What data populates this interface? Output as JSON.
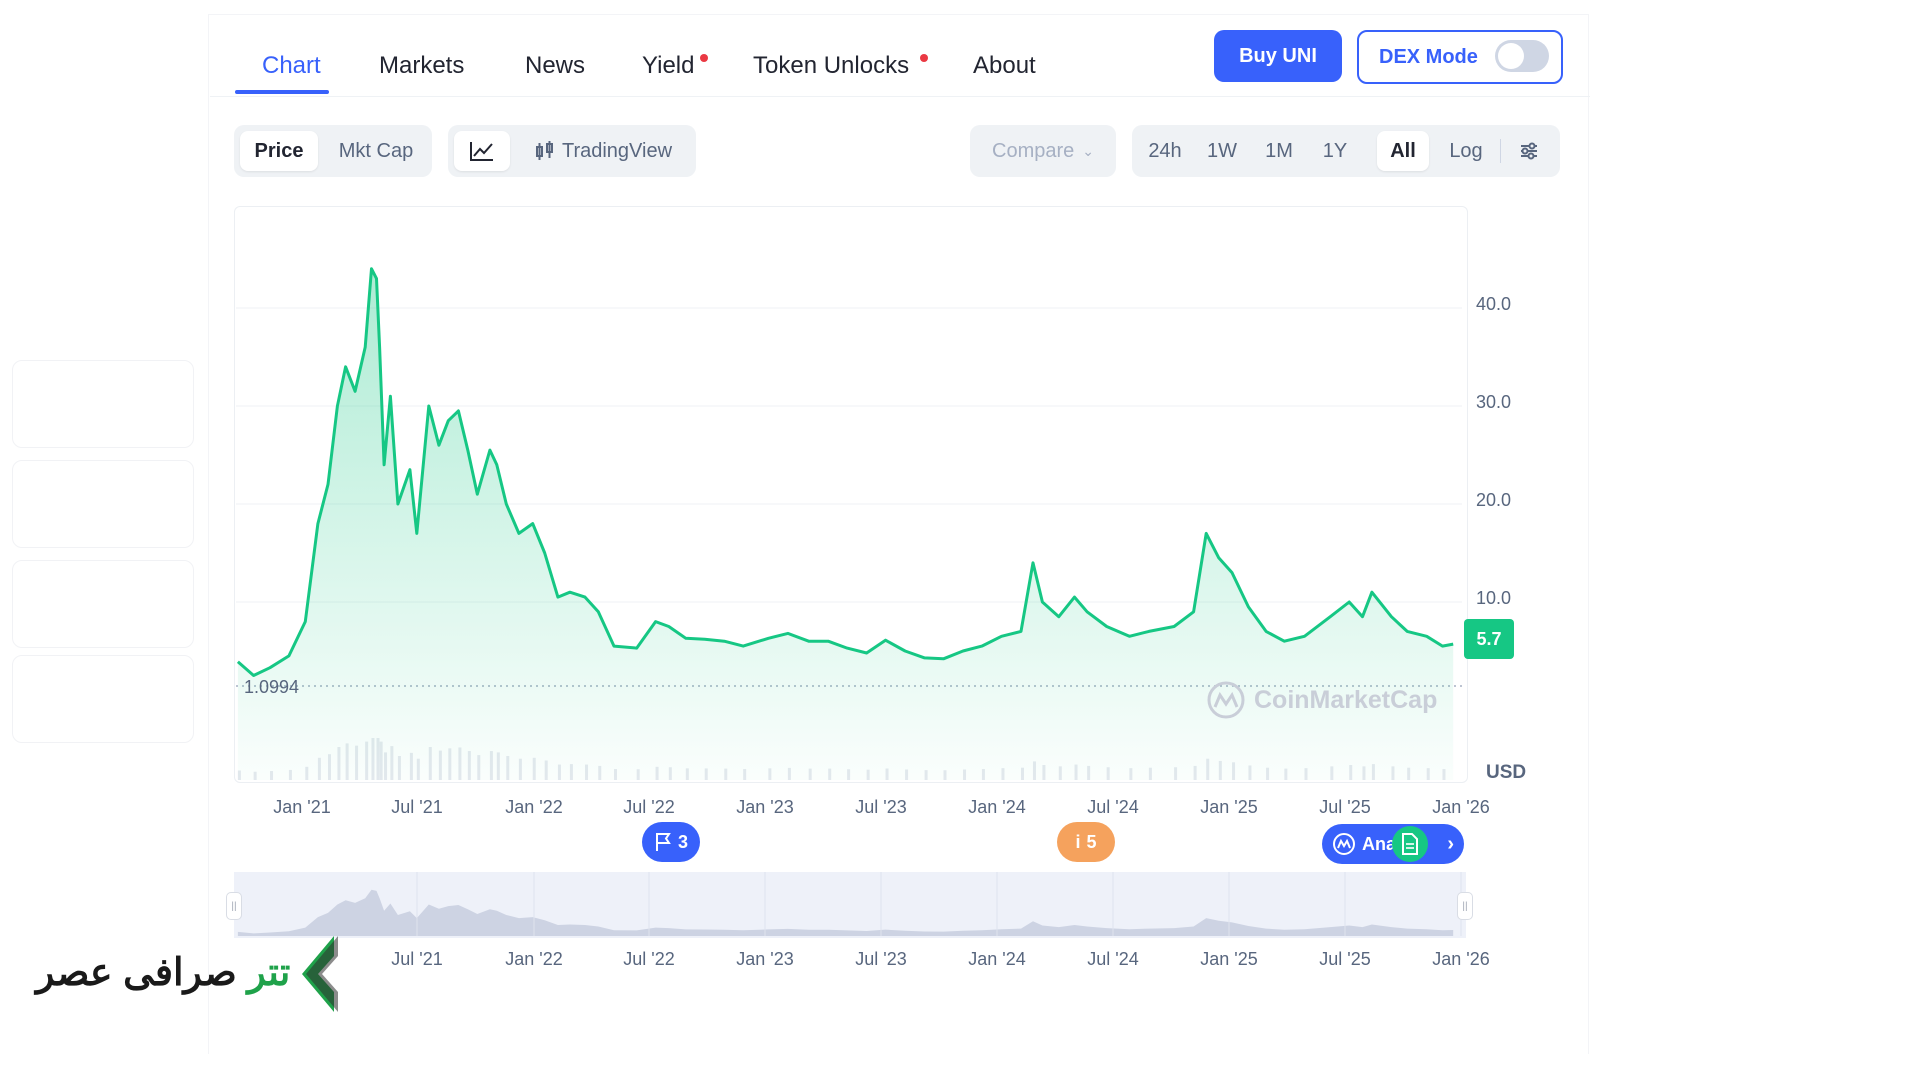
{
  "nav": {
    "tabs": [
      {
        "label": "Chart",
        "active": true
      },
      {
        "label": "Markets"
      },
      {
        "label": "News"
      },
      {
        "label": "Yield",
        "dot": true
      },
      {
        "label": "Token Unlocks",
        "dot": true
      },
      {
        "label": "About"
      }
    ]
  },
  "actions": {
    "buy_label": "Buy UNI",
    "dex_label": "DEX Mode",
    "dex_on": false
  },
  "toolbar": {
    "price_label": "Price",
    "mktcap_label": "Mkt Cap",
    "line_icon": "line-chart-icon",
    "tradingview_label": "TradingView",
    "compare_label": "Compare",
    "ranges": [
      "24h",
      "1W",
      "1M",
      "1Y",
      "All",
      "Log"
    ],
    "selected_range": "All",
    "settings_icon": "sliders-icon"
  },
  "chart": {
    "current_price": "5.7",
    "low_label": "1.0994",
    "currency": "USD",
    "watermark": "CoinMarketCap",
    "y_ticks": [
      "40.0",
      "30.0",
      "20.0",
      "10.0"
    ],
    "x_ticks": [
      "Jan '21",
      "Jul '21",
      "Jan '22",
      "Jul '22",
      "Jan '23",
      "Jul '23",
      "Jan '24",
      "Jul '24",
      "Jan '25",
      "Jul '25",
      "Jan '26"
    ],
    "navigator_ticks": [
      "Jul '21",
      "Jan '22",
      "Jul '22",
      "Jan '23",
      "Jul '23",
      "Jan '24",
      "Jul '24",
      "Jan '25",
      "Jul '25",
      "Jan '26"
    ],
    "markers": {
      "flag_count": "3",
      "info_count": "5",
      "analysis_label": "Ana"
    },
    "colors": {
      "line": "#16c784",
      "accent": "#3861fb",
      "info": "#f5a25d"
    }
  },
  "chart_data": {
    "type": "area",
    "x": [
      "2020-09-20",
      "2020-10-15",
      "2020-11-10",
      "2020-12-10",
      "2021-01-05",
      "2021-01-25",
      "2021-02-10",
      "2021-02-25",
      "2021-03-10",
      "2021-03-25",
      "2021-04-10",
      "2021-04-20",
      "2021-04-28",
      "2021-05-03",
      "2021-05-10",
      "2021-05-20",
      "2021-06-01",
      "2021-06-20",
      "2021-07-01",
      "2021-07-20",
      "2021-08-05",
      "2021-08-20",
      "2021-09-05",
      "2021-09-20",
      "2021-10-05",
      "2021-10-25",
      "2021-11-05",
      "2021-11-20",
      "2021-12-10",
      "2022-01-01",
      "2022-01-20",
      "2022-02-10",
      "2022-03-01",
      "2022-03-25",
      "2022-04-15",
      "2022-05-10",
      "2022-06-15",
      "2022-07-15",
      "2022-08-05",
      "2022-09-01",
      "2022-10-01",
      "2022-11-01",
      "2022-12-01",
      "2023-01-10",
      "2023-02-10",
      "2023-03-15",
      "2023-04-15",
      "2023-05-15",
      "2023-06-15",
      "2023-07-15",
      "2023-08-15",
      "2023-09-15",
      "2023-10-15",
      "2023-11-15",
      "2023-12-15",
      "2024-01-15",
      "2024-02-15",
      "2024-03-05",
      "2024-03-20",
      "2024-04-15",
      "2024-05-10",
      "2024-05-30",
      "2024-06-30",
      "2024-08-05",
      "2024-09-05",
      "2024-10-15",
      "2024-11-15",
      "2024-12-05",
      "2024-12-25",
      "2025-01-15",
      "2025-02-10",
      "2025-03-10",
      "2025-04-08",
      "2025-05-10",
      "2025-06-20",
      "2025-07-20",
      "2025-08-10",
      "2025-08-25",
      "2025-09-25",
      "2025-10-20",
      "2025-11-20",
      "2025-12-15",
      "2026-01-01"
    ],
    "y": [
      3.9,
      2.5,
      3.3,
      4.5,
      8.0,
      18.0,
      22.0,
      30.0,
      34.0,
      31.5,
      36.0,
      44.0,
      43.0,
      36.0,
      24.0,
      31.0,
      20.0,
      23.5,
      17.0,
      30.0,
      26.0,
      28.5,
      29.5,
      25.5,
      21.0,
      25.5,
      24.0,
      20.0,
      17.0,
      18.0,
      15.0,
      10.5,
      11.0,
      10.5,
      9.0,
      5.5,
      5.3,
      8.0,
      7.5,
      6.3,
      6.2,
      6.0,
      5.5,
      6.3,
      6.8,
      6.0,
      6.0,
      5.3,
      4.8,
      6.1,
      5.0,
      4.3,
      4.2,
      5.0,
      5.5,
      6.5,
      7.0,
      14.0,
      10.0,
      8.5,
      10.5,
      9.0,
      7.5,
      6.5,
      7.0,
      7.5,
      9.0,
      17.0,
      14.5,
      13.0,
      9.5,
      7.0,
      6.0,
      6.5,
      8.5,
      10.0,
      8.5,
      11.0,
      8.5,
      7.0,
      6.5,
      5.5,
      5.7
    ],
    "ylim": [
      0,
      50
    ],
    "xlabel": "",
    "ylabel": "USD",
    "grid": true
  }
}
